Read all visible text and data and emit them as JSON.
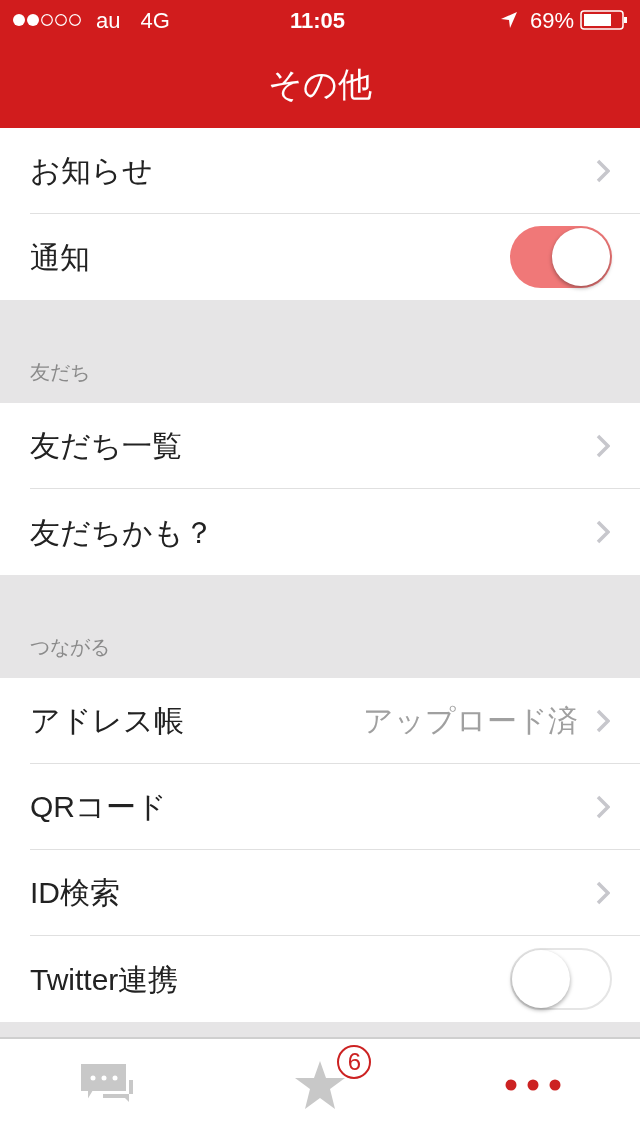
{
  "status_bar": {
    "carrier": "au",
    "network": "4G",
    "time": "11:05",
    "battery": "69%"
  },
  "nav": {
    "title": "その他"
  },
  "sections": [
    {
      "rows": [
        {
          "kind": "link",
          "label": "お知らせ"
        },
        {
          "kind": "toggle",
          "label": "通知",
          "on": true
        }
      ]
    },
    {
      "header": "友だち",
      "rows": [
        {
          "kind": "link",
          "label": "友だち一覧"
        },
        {
          "kind": "link",
          "label": "友だちかも？"
        }
      ]
    },
    {
      "header": "つながる",
      "rows": [
        {
          "kind": "link",
          "label": "アドレス帳",
          "detail": "アップロード済"
        },
        {
          "kind": "link",
          "label": "QRコード"
        },
        {
          "kind": "link",
          "label": "ID検索"
        },
        {
          "kind": "toggle",
          "label": "Twitter連携",
          "on": false
        }
      ]
    }
  ],
  "tabs": [
    {
      "kind": "chat",
      "selected": false
    },
    {
      "kind": "star",
      "selected": false,
      "badge": "6"
    },
    {
      "kind": "more",
      "selected": true
    }
  ]
}
